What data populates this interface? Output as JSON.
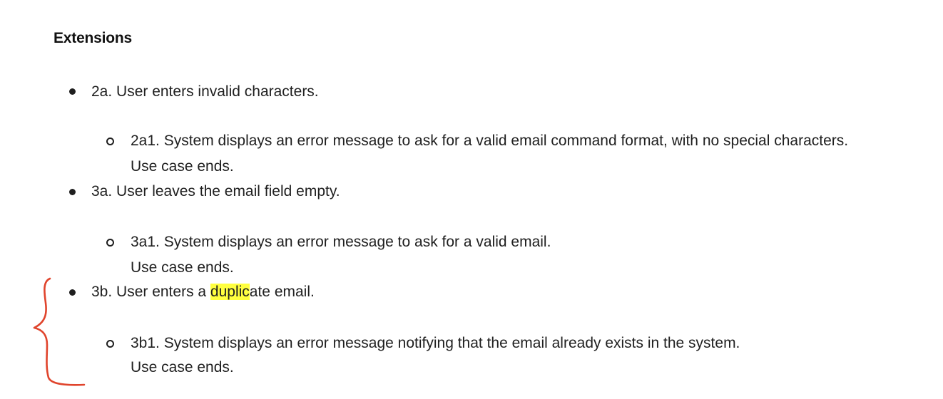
{
  "heading": "Extensions",
  "extensions": [
    {
      "label": "2a. User enters invalid characters.",
      "sub_label": "2a1. System displays an error message to ask for a valid email command format, with no special characters.",
      "sub_continuation": "Use case ends."
    },
    {
      "label": "3a. User leaves the email field empty.",
      "sub_label": "3a1. System displays an error message to ask for a valid email.",
      "sub_continuation": "Use case ends."
    },
    {
      "label_before": "3b. User enters a ",
      "label_highlight": "duplic",
      "label_after": "ate email.",
      "sub_label": "3b1. System displays an error message notifying that the email already exists in the system.",
      "sub_continuation": "Use case ends."
    }
  ],
  "colors": {
    "highlight": "#ffff3f",
    "annotation": "#e0442c",
    "text": "#1f1f1f"
  },
  "annotation_icon": "red-brace-annotation"
}
